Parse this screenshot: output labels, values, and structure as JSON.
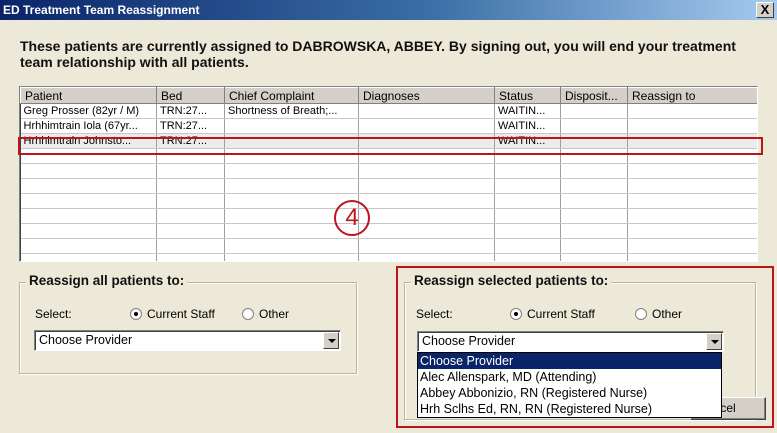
{
  "window": {
    "title": "ED Treatment Team Reassignment",
    "close_label": "X"
  },
  "intro_text": "These patients are currently assigned to DABROWSKA, ABBEY. By signing out, you will end your treatment team relationship with all patients.",
  "grid": {
    "columns": [
      "Patient",
      "Bed",
      "Chief Complaint",
      "Diagnoses",
      "Status",
      "Disposit...",
      "Reassign to"
    ],
    "rows": [
      [
        "Greg Prosser (82yr / M)",
        "TRN:27...",
        "Shortness of Breath;...",
        "",
        "WAITIN...",
        "",
        ""
      ],
      [
        "Hrhhimtrain Iola (67yr...",
        "TRN:27...",
        "",
        "",
        "WAITIN...",
        "",
        ""
      ],
      [
        "Hrhhimtrain Johnsto...",
        "TRN:27...",
        "",
        "",
        "WAITIN...",
        "",
        ""
      ]
    ]
  },
  "step_marker": "4",
  "reassign_all": {
    "legend": "Reassign all patients to:",
    "select_label": "Select:",
    "option_current": "Current Staff",
    "option_other": "Other",
    "combo_value": "Choose Provider"
  },
  "reassign_selected": {
    "legend": "Reassign selected patients to:",
    "select_label": "Select:",
    "option_current": "Current Staff",
    "option_other": "Other",
    "combo_value": "Choose Provider",
    "dropdown_options": [
      "Choose Provider",
      "Alec Allenspark, MD  (Attending)",
      "Abbey Abbonizio, RN  (Registered Nurse)",
      "Hrh Sclhs Ed, RN, RN  (Registered Nurse)"
    ]
  },
  "buttons": {
    "cancel_partial": "cel"
  },
  "colors": {
    "highlight": "#c0141c",
    "selection": "#0a246a",
    "dialog_bg": "#ece9d8"
  }
}
